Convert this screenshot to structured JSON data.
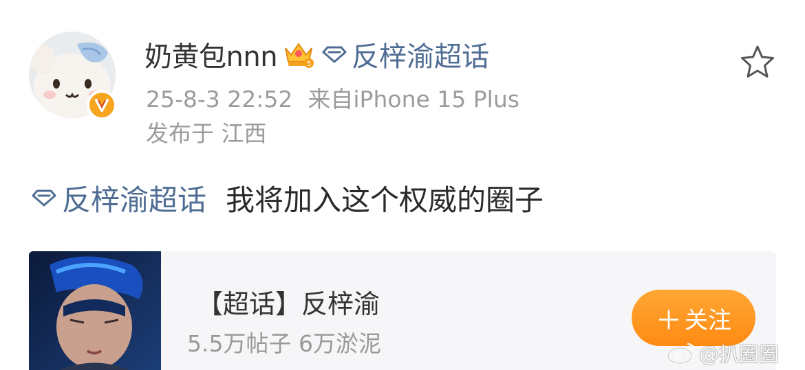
{
  "post": {
    "author": {
      "username": "奶黄包nnn",
      "crown_icon": "crown-level-5-icon",
      "verified_icon": "orange-v-badge-icon"
    },
    "header_topic": {
      "icon": "diamond-topic-icon",
      "name": "反梓渝超话"
    },
    "meta": {
      "time": "25-8-3 22:52",
      "source": "来自iPhone 15 Plus",
      "location": "发布于 江西"
    },
    "actions": {
      "favorite_icon": "star-icon"
    },
    "content": {
      "topic_icon": "diamond-topic-icon",
      "topic_link": "反梓渝超话",
      "text": "我将加入这个权威的圈子"
    }
  },
  "card": {
    "title": "【超话】反梓渝",
    "stats": "5.5万帖子 6万淤泥",
    "follow_label": "关注",
    "follow_icon": "plus-icon"
  },
  "watermark": {
    "logo": "weibo-logo-icon",
    "text": "@扒圈圈"
  },
  "colors": {
    "link": "#4f6d94",
    "meta": "#9b9b9b",
    "follow_button": "#ff9a22",
    "badge": "#f7a51f"
  }
}
